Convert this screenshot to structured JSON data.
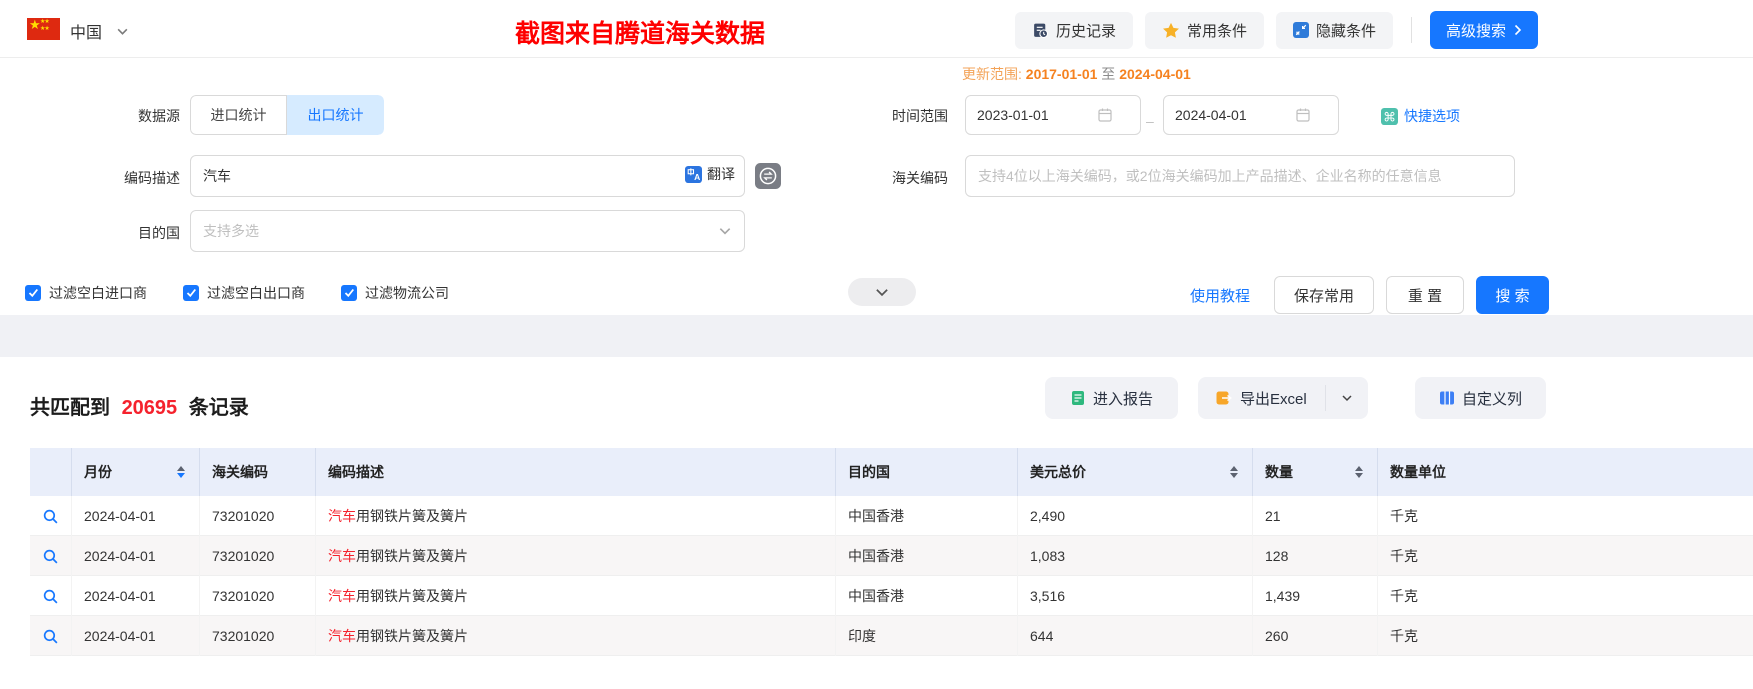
{
  "colors": {
    "accent": "#1677ff",
    "highlight_red": "#f5222d",
    "update_orange": "#f58220",
    "watermark_red": "#fe0000",
    "tab_active_bg": "#d6ebff",
    "table_header_bg": "#e9eefa"
  },
  "topbar": {
    "country": "中国",
    "watermark": "截图来自腾道海关数据",
    "history_btn": "历史记录",
    "favorites_btn": "常用条件",
    "hide_btn": "隐藏条件",
    "advanced_btn": "高级搜索"
  },
  "form": {
    "update_range": {
      "label": "更新范围:",
      "from": "2017-01-01",
      "to_word": "至",
      "to": "2024-04-01"
    },
    "data_source": {
      "label": "数据源",
      "import_tab": "进口统计",
      "export_tab": "出口统计"
    },
    "time_range": {
      "label": "时间范围",
      "from": "2023-01-01",
      "separator": "–",
      "to": "2024-04-01",
      "quick_options": "快捷选项"
    },
    "code_desc": {
      "label": "编码描述",
      "value": "汽车",
      "translate": "翻译"
    },
    "hs_code": {
      "label": "海关编码",
      "placeholder": "支持4位以上海关编码，或2位海关编码加上产品描述、企业名称的任意信息"
    },
    "dest_country": {
      "label": "目的国",
      "placeholder": "支持多选"
    },
    "filters": [
      {
        "label": "过滤空白进口商",
        "checked": true
      },
      {
        "label": "过滤空白出口商",
        "checked": true
      },
      {
        "label": "过滤物流公司",
        "checked": true
      }
    ],
    "actions": {
      "tutorial": "使用教程",
      "save": "保存常用",
      "reset": "重 置",
      "search": "搜 索"
    }
  },
  "results": {
    "summary": {
      "prefix": "共匹配到",
      "count": "20695",
      "suffix": "条记录"
    },
    "toolbar": {
      "report": "进入报告",
      "export": "导出Excel",
      "custom_columns": "自定义列"
    },
    "table": {
      "columns": [
        "月份",
        "海关编码",
        "编码描述",
        "目的国",
        "美元总价",
        "数量",
        "数量单位"
      ],
      "rows": [
        {
          "month": "2024-04-01",
          "hs_code": "73201020",
          "desc_highlight": "汽车",
          "desc_rest": "用钢铁片簧及簧片",
          "country": "中国香港",
          "usd": "2,490",
          "qty": "21",
          "unit": "千克"
        },
        {
          "month": "2024-04-01",
          "hs_code": "73201020",
          "desc_highlight": "汽车",
          "desc_rest": "用钢铁片簧及簧片",
          "country": "中国香港",
          "usd": "1,083",
          "qty": "128",
          "unit": "千克"
        },
        {
          "month": "2024-04-01",
          "hs_code": "73201020",
          "desc_highlight": "汽车",
          "desc_rest": "用钢铁片簧及簧片",
          "country": "中国香港",
          "usd": "3,516",
          "qty": "1,439",
          "unit": "千克"
        },
        {
          "month": "2024-04-01",
          "hs_code": "73201020",
          "desc_highlight": "汽车",
          "desc_rest": "用钢铁片簧及簧片",
          "country": "印度",
          "usd": "644",
          "qty": "260",
          "unit": "千克"
        }
      ]
    }
  }
}
